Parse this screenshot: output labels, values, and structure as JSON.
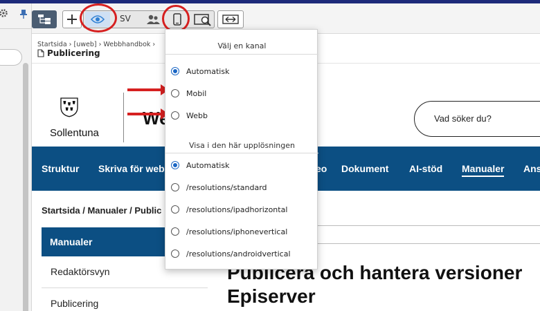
{
  "toolbar": {
    "language": "SV"
  },
  "cms_breadcrumb": {
    "path": "Startsida › [uweb] › Webbhandbok ›",
    "page_title": "Publicering"
  },
  "site": {
    "logo_text": "Sollentuna",
    "title_visible": "We",
    "search_placeholder": "Vad söker du?",
    "nav": [
      "Struktur",
      "Skriva för web",
      "eo",
      "Dokument",
      "AI-stöd",
      "Manualer",
      "Ans"
    ],
    "page_breadcrumb": "Startsida / Manualer / Public",
    "side_nav": {
      "active": "Manualer",
      "items": [
        "Redaktörsvyn",
        "Publicering"
      ]
    },
    "article_title_line1": "Publicera och hantera versioner",
    "article_title_line2": "Episerver"
  },
  "channel_popup": {
    "channel_heading": "Välj en kanal",
    "channels": [
      {
        "label": "Automatisk",
        "selected": true
      },
      {
        "label": "Mobil",
        "selected": false
      },
      {
        "label": "Webb",
        "selected": false
      }
    ],
    "resolution_heading": "Visa i den här upplösningen",
    "resolutions": [
      {
        "label": "Automatisk",
        "selected": true
      },
      {
        "label": "/resolutions/standard",
        "selected": false
      },
      {
        "label": "/resolutions/ipadhorizontal",
        "selected": false
      },
      {
        "label": "/resolutions/iphonevertical",
        "selected": false
      },
      {
        "label": "/resolutions/androidvertical",
        "selected": false
      }
    ]
  },
  "colors": {
    "nav_blue": "#0c4f83",
    "annotation_red": "#d62020",
    "radio_blue": "#1a66c4"
  }
}
